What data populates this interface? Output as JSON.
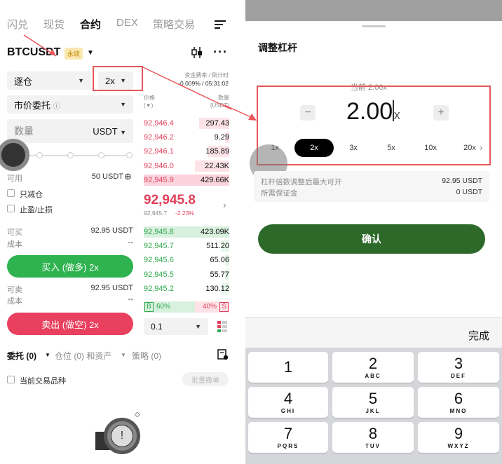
{
  "left": {
    "nav": [
      "闪兑",
      "现货",
      "合约",
      "DEX",
      "策略交易"
    ],
    "nav_active": "合约",
    "symbol": "BTCUSDT",
    "symbol_badge": "永续",
    "margin_mode": "逐仓",
    "leverage": "2x",
    "funding_label": "资金费率 / 倒计时",
    "funding_value": "-0.009% / 05:31:02",
    "order_type": "市价委托",
    "qty_placeholder": "数量",
    "qty_unit": "USDT",
    "price_col": "价格",
    "price_unit": "(▼)",
    "qty_col": "数量",
    "qty_col_unit": "(USDT)",
    "asks": [
      {
        "price": "92,946.4",
        "qty": "297.43",
        "depth": 0.35
      },
      {
        "price": "92,946.2",
        "qty": "9.29",
        "depth": 0.05
      },
      {
        "price": "92,946.1",
        "qty": "185.89",
        "depth": 0.25
      },
      {
        "price": "92,946.0",
        "qty": "22.43K",
        "depth": 0.4
      },
      {
        "price": "92,945.9",
        "qty": "429.66K",
        "depth": 1.0
      }
    ],
    "last_price": "92,945.8",
    "mark_price": "92,945.7",
    "change": "-2.23%",
    "bids": [
      {
        "price": "92,945.8",
        "qty": "423.09K",
        "depth": 1.0
      },
      {
        "price": "92,945.7",
        "qty": "511.20",
        "depth": 0.1
      },
      {
        "price": "92,945.6",
        "qty": "65.06",
        "depth": 0.05
      },
      {
        "price": "92,945.5",
        "qty": "55.77",
        "depth": 0.05
      },
      {
        "price": "92,945.2",
        "qty": "130.12",
        "depth": 0.1
      }
    ],
    "buy_ratio": "60%",
    "sell_ratio": "40%",
    "buy_ratio_value": 60,
    "ratio_b": "B",
    "ratio_s": "S",
    "tick_size": "0.1",
    "available_label": "可用",
    "available_value": "50 USDT",
    "reduce_only": "只减仓",
    "tp_sl": "止盈/止损",
    "can_buy_label": "可买",
    "can_buy_value": "92.95 USDT",
    "cost_label": "成本",
    "cost_value": "--",
    "buy_button": "买入 (做多) 2x",
    "can_sell_label": "可卖",
    "can_sell_value": "92.95 USDT",
    "cost_label2": "成本",
    "cost_value2": "--",
    "sell_button": "卖出 (做空) 2x",
    "bottom_tabs": [
      "委托 (0)",
      "仓位 (0) 和资产",
      "策略 (0)"
    ],
    "current_symbol": "当前交易品种",
    "batch_cancel": "批量撤单",
    "colors": {
      "green": "#2fa84f",
      "red": "#e0405a",
      "highlight": "#e8575a"
    }
  },
  "right": {
    "title": "调整杠杆",
    "current": "当前 2.00x",
    "value": "2.00",
    "unit": "x",
    "minus": "−",
    "plus": "+",
    "options": [
      "1x",
      "2x",
      "3x",
      "5x",
      "10x",
      "20x"
    ],
    "selected": "2x",
    "max_label": "杠杆倍数调整后最大可开",
    "max_value": "92.95 USDT",
    "margin_label": "所需保证金",
    "margin_value": "0 USDT",
    "confirm": "确认",
    "done": "完成",
    "keys": [
      {
        "d": "1",
        "l": ""
      },
      {
        "d": "2",
        "l": "ABC"
      },
      {
        "d": "3",
        "l": "DEF"
      },
      {
        "d": "4",
        "l": "GHI"
      },
      {
        "d": "5",
        "l": "JKL"
      },
      {
        "d": "6",
        "l": "MNO"
      },
      {
        "d": "7",
        "l": "PQRS"
      },
      {
        "d": "8",
        "l": "TUV"
      },
      {
        "d": "9",
        "l": "WXYZ"
      }
    ],
    "colors": {
      "confirm": "#2d6a2a",
      "keyboard": "#d4d6da"
    }
  }
}
